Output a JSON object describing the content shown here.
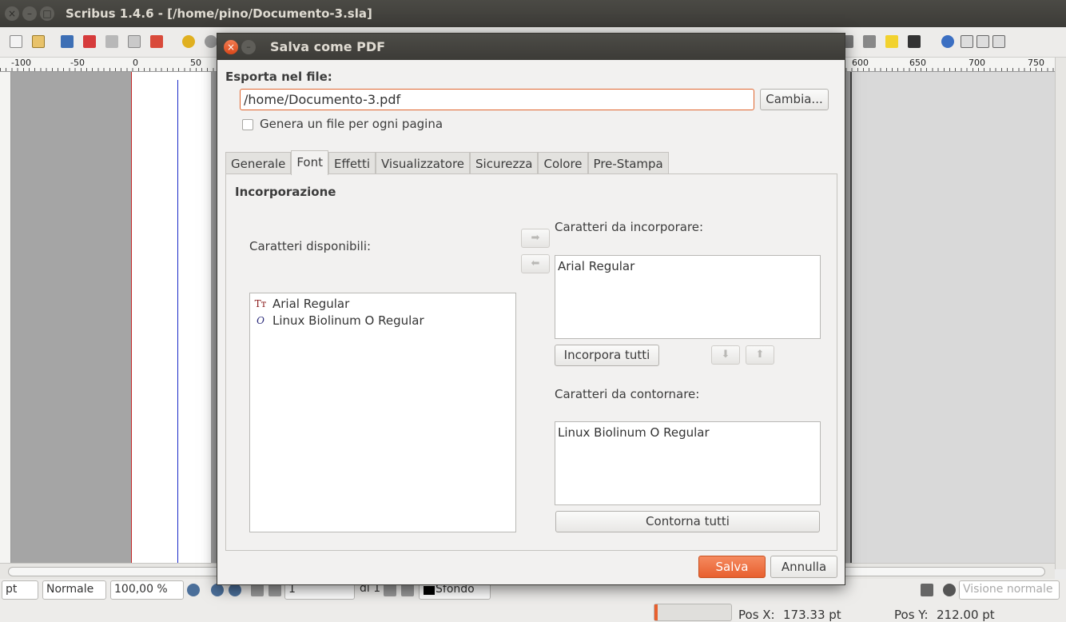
{
  "window": {
    "title": "Scribus 1.4.6 - [/home/pino/Documento-3.sla]",
    "close_glyph": "×",
    "minimize_glyph": "–",
    "maximize_glyph": "□"
  },
  "ruler": {
    "h_labels": [
      "-100",
      "-50",
      "0",
      "50",
      "600",
      "650",
      "700",
      "750"
    ]
  },
  "statusbar": {
    "unit": "pt",
    "mode": "Normale",
    "zoom": "100,00 %",
    "page_current": "1",
    "page_total": "di 1",
    "layer": "Sfondo",
    "view_mode": "Visione normale",
    "pos_x_label": "Pos X:",
    "pos_x_value": "173.33 pt",
    "pos_y_label": "Pos Y:",
    "pos_y_value": "212.00 pt"
  },
  "dialog": {
    "title": "Salva come PDF",
    "export_label": "Esporta nel file:",
    "file_path": "/home/Documento-3.pdf",
    "change_button": "Cambia...",
    "per_page_checkbox": "Genera un file per ogni pagina",
    "tabs": [
      "Generale",
      "Font",
      "Effetti",
      "Visualizzatore",
      "Sicurezza",
      "Colore",
      "Pre-Stampa"
    ],
    "active_tab": "Font",
    "section_title": "Incorporazione",
    "available_label": "Caratteri disponibili:",
    "available_fonts": [
      {
        "name": "Arial Regular",
        "icon": "truetype-font-icon",
        "glyph": "Tт"
      },
      {
        "name": "Linux Biolinum O Regular",
        "icon": "opentype-font-icon",
        "glyph": "O"
      }
    ],
    "embed_label": "Caratteri da incorporare:",
    "embed_fonts": [
      "Arial Regular"
    ],
    "embed_all_button": "Incorpora tutti",
    "outline_label": "Caratteri da contornare:",
    "outline_fonts": [
      "Linux Biolinum O Regular"
    ],
    "outline_all_button": "Contorna tutti",
    "save_button": "Salva",
    "cancel_button": "Annulla",
    "arrow_right": "➡",
    "arrow_left": "⬅",
    "arrow_down": "⬇",
    "arrow_up": "⬆"
  },
  "colors": {
    "accent": "#e8602f",
    "title_bar": "#3c3b37"
  }
}
